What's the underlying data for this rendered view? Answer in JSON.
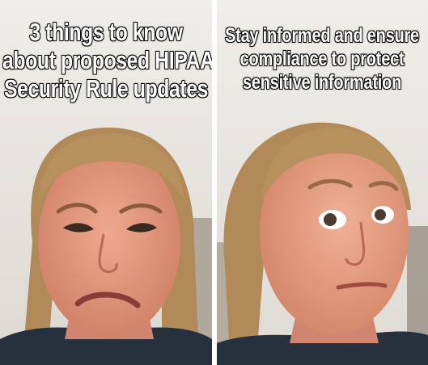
{
  "meme": {
    "left_panel": {
      "caption_lines": [
        "3 things to know",
        "about proposed HIPAA",
        "Security Rule updates"
      ],
      "expression": "disgusted-frown"
    },
    "right_panel": {
      "caption_lines": [
        "Stay informed and ensure",
        "compliance to protect",
        "sensitive information"
      ],
      "expression": "wide-eyed-approval"
    }
  },
  "colors": {
    "caption_text": "#ffffff",
    "caption_outline": "#000000",
    "divider": "#ffffff",
    "wall": "#e9e6e1",
    "hair": "#b28a5a",
    "skin": "#e8a083",
    "shirt": "#27303d"
  }
}
